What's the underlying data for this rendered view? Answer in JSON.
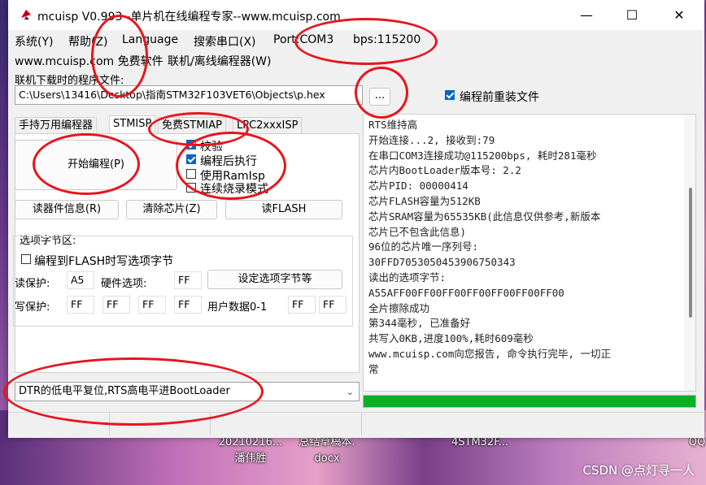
{
  "window": {
    "title": "mcuisp V0.993--单片机在线编程专家--www.mcuisp.com",
    "minimize": "—",
    "maximize": "☐",
    "close": "✕"
  },
  "menu": [
    "系统(Y)",
    "帮助(Z)",
    "Language",
    "搜索串口(X)",
    "Port:COM3",
    "bps:115200"
  ],
  "menu2": [
    "www.mcuisp.com 免费软件",
    "联机/离线编程器(W)"
  ],
  "file": {
    "label": "联机下载时的程序文件:",
    "path": "C:\\Users\\13416\\Desktop\\指南STM32F103VET6\\Objects\\p.hex",
    "browse": "...",
    "reload_label": "编程前重装文件",
    "reload_checked": true
  },
  "tabs": [
    "手持万用编程器",
    "STMISP",
    "免费STMIAP",
    "LPC2xxxISP"
  ],
  "active_tab": 1,
  "stmisp": {
    "start": "开始编程(P)",
    "options": [
      {
        "label": "校验",
        "checked": true
      },
      {
        "label": "编程后执行",
        "checked": true
      },
      {
        "label": "使用RamIsp",
        "checked": false
      },
      {
        "label": "连续烧录模式",
        "checked": false
      }
    ],
    "read_info": "读器件信息(R)",
    "erase": "清除芯片(Z)",
    "read_flash": "读FLASH",
    "option_group": "选项字节区:",
    "write_option_label": "编程到FLASH时写选项字节",
    "write_option_checked": false,
    "read_protect_label": "读保护:",
    "read_protect_value": "A5",
    "hw_option_label": "硬件选项:",
    "hw_option_value": "FF",
    "set_option_btn": "设定选项字节等",
    "write_protect_label": "写保护:",
    "write_protect_values": [
      "FF",
      "FF",
      "FF",
      "FF"
    ],
    "user_data_label": "用户数据0-1",
    "user_data_values": [
      "FF",
      "FF"
    ]
  },
  "dtr_select": "DTR的低电平复位,RTS高电平进BootLoader",
  "log": [
    "RTS维持高",
    "开始连接...2, 接收到:79",
    "在串口COM3连接成功@115200bps, 耗时281毫秒",
    "芯片内BootLoader版本号: 2.2",
    "芯片PID: 00000414",
    "芯片FLASH容量为512KB",
    "芯片SRAM容量为65535KB(此信息仅供参考,新版本",
    "芯片已不包含此信息)",
    "96位的芯片唯一序列号:",
    "30FFD7053050453906750343",
    "读出的选项字节:",
    "A55AFF00FF00FF00FF00FF00FF00FF00",
    "全片擦除成功",
    "第344毫秒, 已准备好",
    "共写入0KB,进度100%,耗时609毫秒",
    "www.mcuisp.com向您报告, 命令执行完毕, 一切正",
    "常"
  ],
  "progress": 1.0,
  "desktop": {
    "file1_line1": "20210216...",
    "file1_line2": "潘伟胜",
    "file2_line1": "总结草稿本.",
    "file2_line2": "docx",
    "file3": "4STM32F...",
    "corner": "QQ",
    "watermark": "CSDN @点灯寻一人"
  },
  "colors": {
    "accent": "#0067c0",
    "progress": "#06b025",
    "annotation": "#e8141c"
  }
}
